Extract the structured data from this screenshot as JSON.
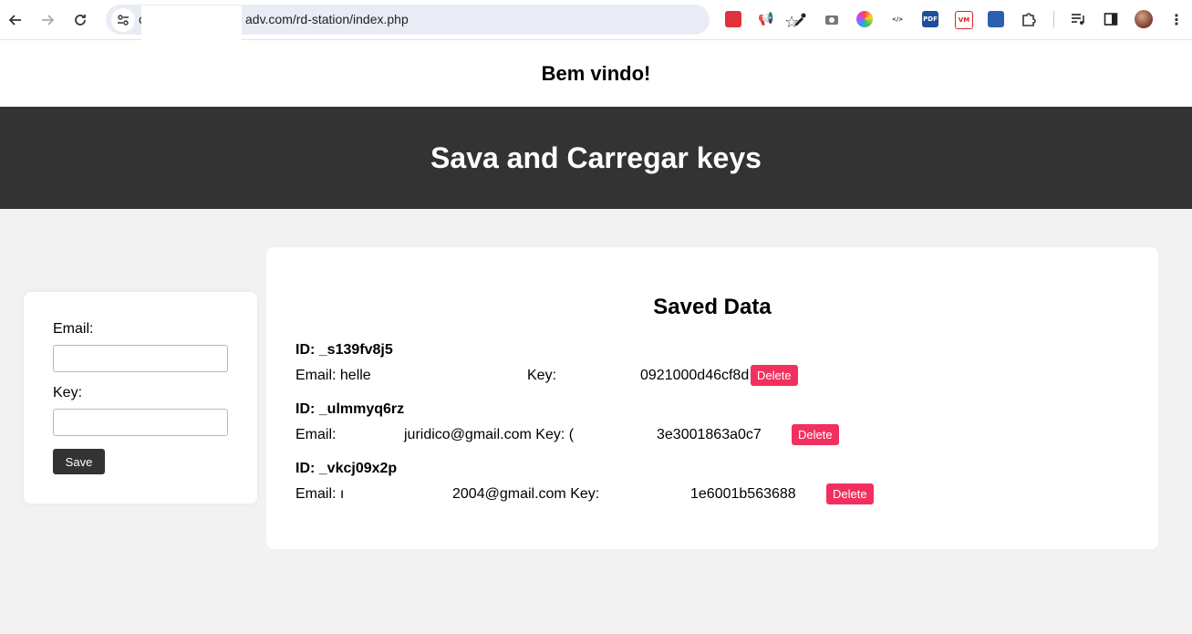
{
  "browser": {
    "url_visible": "adv.com/rd-station/index.php",
    "url_prefix": "c"
  },
  "page": {
    "welcome": "Bem vindo!",
    "banner_title": "Sava and Carregar keys"
  },
  "form": {
    "email_label": "Email:",
    "key_label": "Key:",
    "save_label": "Save"
  },
  "saved": {
    "title": "Saved Data",
    "records": [
      {
        "id_label": "ID: _s139fv8j5",
        "email_prefix": "Email: helle",
        "email_suffix": "",
        "key_label": "Key:",
        "key_suffix": "0921000d46cf8d",
        "delete_label": "Delete"
      },
      {
        "id_label": "ID: _ulmmyq6rz",
        "email_prefix": "Email:",
        "email_suffix": "juridico@gmail.com Key: (",
        "key_label": "",
        "key_suffix": "3e3001863a0c7",
        "delete_label": "Delete"
      },
      {
        "id_label": "ID: _vkcj09x2p",
        "email_prefix": "Email: ı",
        "email_suffix": "2004@gmail.com Key:",
        "key_label": "",
        "key_suffix": "1e6001b563688",
        "delete_label": "Delete"
      }
    ]
  },
  "colors": {
    "banner_bg": "#333333",
    "delete_bg": "#f2305f",
    "page_bg": "#f2f2f2"
  }
}
